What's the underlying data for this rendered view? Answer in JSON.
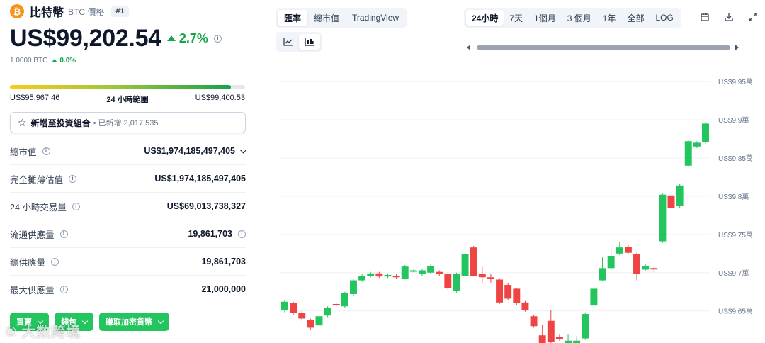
{
  "coin": {
    "icon_letter": "₿",
    "name": "比特幣",
    "subtitle": "BTC 價格",
    "rank": "#1",
    "price": "US$99,202.54",
    "change_pct": "2.7%",
    "btc_amount": "1.0000 BTC",
    "btc_change": "0.0%",
    "accent_color": "#f7931a",
    "up_color": "#16a34a"
  },
  "range24h": {
    "low": "US$95,967.46",
    "label": "24 小時範圍",
    "high": "US$99,400.53",
    "position_pct": 94
  },
  "portfolio": {
    "label": "新增至投資組合",
    "count": "• 已新增 2,017,535"
  },
  "stats": [
    {
      "label": "總市值",
      "value": "US$1,974,185,497,405",
      "has_chevron": true
    },
    {
      "label": "完全攤薄估值",
      "value": "US$1,974,185,497,405"
    },
    {
      "label": "24 小時交易量",
      "value": "US$69,013,738,327"
    },
    {
      "label": "流通供應量",
      "value": "19,861,703",
      "has_info": true
    },
    {
      "label": "總供應量",
      "value": "19,861,703"
    },
    {
      "label": "最大供應量",
      "value": "21,000,000"
    }
  ],
  "actions": {
    "buy": "買賣",
    "wallet": "錢包",
    "earn": "賺取加密貨幣"
  },
  "watermark": "大数跨境",
  "tabs": [
    "匯率",
    "總市值",
    "TradingView"
  ],
  "active_tab": "匯率",
  "chart_modes": [
    {
      "icon": "line-chart-icon",
      "active": false
    },
    {
      "icon": "candlestick-chart-icon",
      "active": true
    }
  ],
  "time_ranges": [
    "24小時",
    "7天",
    "1個月",
    "3 個月",
    "1年",
    "全部",
    "LOG"
  ],
  "active_range": "24小時",
  "tools": [
    "calendar-icon",
    "download-icon",
    "expand-icon"
  ],
  "chart_data": {
    "type": "candlestick",
    "y_ticks": [
      "US$9.95萬",
      "US$9.9萬",
      "US$9.85萬",
      "US$9.8萬",
      "US$9.75萬",
      "US$9.7萬",
      "US$9.65萬"
    ],
    "y_tick_values": [
      99500,
      99000,
      98500,
      98000,
      97500,
      97000,
      96500
    ],
    "ylim": [
      96080,
      99640
    ],
    "grid": true,
    "up_color": "#22c55e",
    "down_color": "#ef4444",
    "candles": [
      {
        "o": 96510,
        "c": 96620,
        "h": 96640,
        "l": 96480
      },
      {
        "o": 96600,
        "c": 96470,
        "h": 96620,
        "l": 96450
      },
      {
        "o": 96470,
        "c": 96400,
        "h": 96500,
        "l": 96370
      },
      {
        "o": 96380,
        "c": 96280,
        "h": 96400,
        "l": 96250
      },
      {
        "o": 96310,
        "c": 96430,
        "h": 96450,
        "l": 96290
      },
      {
        "o": 96440,
        "c": 96540,
        "h": 96560,
        "l": 96410
      },
      {
        "o": 96590,
        "c": 96580,
        "h": 96610,
        "l": 96560
      },
      {
        "o": 96560,
        "c": 96730,
        "h": 96750,
        "l": 96540
      },
      {
        "o": 96720,
        "c": 96900,
        "h": 96920,
        "l": 96700
      },
      {
        "o": 96900,
        "c": 96960,
        "h": 96980,
        "l": 96880
      },
      {
        "o": 96960,
        "c": 96990,
        "h": 97010,
        "l": 96940
      },
      {
        "o": 96990,
        "c": 96950,
        "h": 97010,
        "l": 96930
      },
      {
        "o": 96950,
        "c": 96970,
        "h": 96990,
        "l": 96930
      },
      {
        "o": 96960,
        "c": 96940,
        "h": 96980,
        "l": 96920
      },
      {
        "o": 96920,
        "c": 97080,
        "h": 97100,
        "l": 96910
      },
      {
        "o": 97020,
        "c": 97030,
        "h": 97040,
        "l": 97010
      },
      {
        "o": 96980,
        "c": 97030,
        "h": 97050,
        "l": 96960
      },
      {
        "o": 97000,
        "c": 97090,
        "h": 97110,
        "l": 96980
      },
      {
        "o": 97010,
        "c": 96980,
        "h": 97030,
        "l": 96960
      },
      {
        "o": 96980,
        "c": 96800,
        "h": 97000,
        "l": 96780
      },
      {
        "o": 96760,
        "c": 96980,
        "h": 97000,
        "l": 96740
      },
      {
        "o": 96960,
        "c": 97240,
        "h": 97260,
        "l": 96940
      },
      {
        "o": 97330,
        "c": 96960,
        "h": 97350,
        "l": 96950
      },
      {
        "o": 96980,
        "c": 96940,
        "h": 97080,
        "l": 96860
      },
      {
        "o": 96940,
        "c": 96920,
        "h": 96990,
        "l": 96870
      },
      {
        "o": 96910,
        "c": 96610,
        "h": 96930,
        "l": 96590
      },
      {
        "o": 96840,
        "c": 96660,
        "h": 96860,
        "l": 96640
      },
      {
        "o": 96790,
        "c": 96600,
        "h": 96800,
        "l": 96580
      },
      {
        "o": 96610,
        "c": 96510,
        "h": 96630,
        "l": 96490
      },
      {
        "o": 96430,
        "c": 96300,
        "h": 96450,
        "l": 96280
      },
      {
        "o": 96180,
        "c": 96070,
        "h": 96320,
        "l": 96050
      },
      {
        "o": 96370,
        "c": 96090,
        "h": 96510,
        "l": 96060
      },
      {
        "o": 96160,
        "c": 96130,
        "h": 96190,
        "l": 96110
      },
      {
        "o": 96070,
        "c": 96110,
        "h": 96190,
        "l": 96040
      },
      {
        "o": 96070,
        "c": 96110,
        "h": 96170,
        "l": 96040
      },
      {
        "o": 96140,
        "c": 96460,
        "h": 96480,
        "l": 96120
      },
      {
        "o": 96570,
        "c": 96790,
        "h": 96810,
        "l": 96550
      },
      {
        "o": 96900,
        "c": 97060,
        "h": 97200,
        "l": 96890
      },
      {
        "o": 97060,
        "c": 97220,
        "h": 97300,
        "l": 97040
      },
      {
        "o": 97250,
        "c": 97330,
        "h": 97400,
        "l": 97230
      },
      {
        "o": 97340,
        "c": 97260,
        "h": 97360,
        "l": 97240
      },
      {
        "o": 97240,
        "c": 96980,
        "h": 97260,
        "l": 96900
      },
      {
        "o": 97040,
        "c": 97090,
        "h": 97110,
        "l": 97020
      },
      {
        "o": 97060,
        "c": 97050,
        "h": 97070,
        "l": 97000
      },
      {
        "o": 97410,
        "c": 98020,
        "h": 98040,
        "l": 97390
      },
      {
        "o": 98010,
        "c": 97850,
        "h": 98030,
        "l": 97830
      },
      {
        "o": 97870,
        "c": 98140,
        "h": 98160,
        "l": 97850
      },
      {
        "o": 98400,
        "c": 98720,
        "h": 98740,
        "l": 98380
      },
      {
        "o": 98650,
        "c": 98700,
        "h": 98720,
        "l": 98630
      },
      {
        "o": 98710,
        "c": 98950,
        "h": 98970,
        "l": 98690
      }
    ]
  }
}
